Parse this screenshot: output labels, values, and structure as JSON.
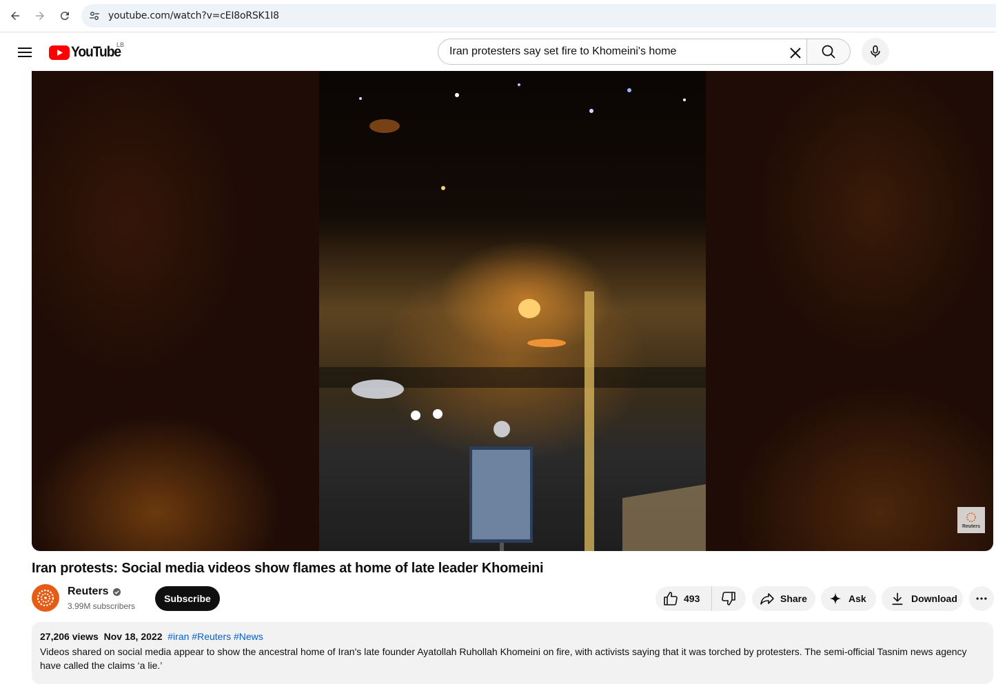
{
  "browser": {
    "url": "youtube.com/watch?v=cEI8oRSK1I8"
  },
  "header": {
    "logo_text": "YouTube",
    "region": "LB",
    "search_value": "Iran protesters say set fire to Khomeini's home"
  },
  "video": {
    "watermark": "Reuters",
    "title": "Iran protests: Social media videos show flames at home of late leader Khomeini"
  },
  "channel": {
    "name": "Reuters",
    "subscribers": "3.99M subscribers",
    "subscribe_label": "Subscribe"
  },
  "actions": {
    "likes": "493",
    "share_label": "Share",
    "ask_label": "Ask",
    "download_label": "Download"
  },
  "description": {
    "views": "27,206 views",
    "date": "Nov 18, 2022",
    "tags": [
      "#iran",
      "#Reuters",
      "#News"
    ],
    "text": "Videos shared on social media appear to show the ancestral home of Iran's late founder Ayatollah Ruhollah Khomeini on fire, with activists saying that it was torched by protesters. The semi-official Tasnim news agency have called the claims ‘a lie.’"
  },
  "colors": {
    "brand_red": "#ff0000",
    "link_blue": "#065fd4",
    "channel_orange": "#e65c14"
  }
}
